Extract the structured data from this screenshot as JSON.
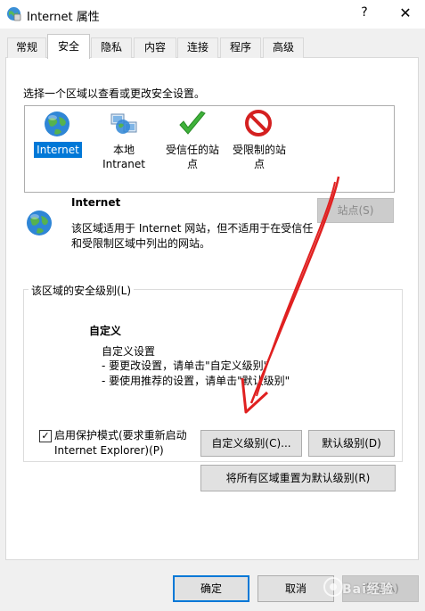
{
  "window": {
    "title": "Internet 属性",
    "help_glyph": "?",
    "close_glyph": "✕"
  },
  "tabs": [
    {
      "label": "常规",
      "active": false
    },
    {
      "label": "安全",
      "active": true
    },
    {
      "label": "隐私",
      "active": false
    },
    {
      "label": "内容",
      "active": false
    },
    {
      "label": "连接",
      "active": false
    },
    {
      "label": "程序",
      "active": false
    },
    {
      "label": "高级",
      "active": false
    }
  ],
  "security": {
    "zone_prompt": "选择一个区域以查看或更改安全设置。",
    "zones": [
      {
        "label": "Internet",
        "icon": "globe-icon",
        "selected": true
      },
      {
        "label": "本地\nIntranet",
        "icon": "intranet-globe-icon",
        "selected": false
      },
      {
        "label": "受信任的站\n点",
        "icon": "check-icon",
        "selected": false
      },
      {
        "label": "受限制的站\n点",
        "icon": "no-entry-icon",
        "selected": false
      }
    ],
    "zone_title": "Internet",
    "zone_desc": "该区域适用于 Internet 网站，但不适用于在受信任和受限制区域中列出的网站。",
    "sites_button": "站点(S)"
  },
  "level": {
    "legend": "该区域的安全级别(L)",
    "custom_title": "自定义",
    "custom_sub": "自定义设置",
    "custom_line1": "- 要更改设置，请单击\"自定义级别\"",
    "custom_line2": "- 要使用推荐的设置，请单击\"默认级别\"",
    "protected_mode_label": "启用保护模式(要求重新启动 Internet Explorer)(P)",
    "protected_mode_checked": true,
    "check_glyph": "✓",
    "custom_level_button": "自定义级别(C)...",
    "default_level_button": "默认级别(D)",
    "reset_all_button": "将所有区域重置为默认级别(R)"
  },
  "footer": {
    "ok": "确定",
    "cancel": "取消",
    "apply": "应用(A)"
  },
  "watermark": "Bai经验",
  "colors": {
    "selection": "#0078d7",
    "annotation_arrow": "#e02020"
  }
}
